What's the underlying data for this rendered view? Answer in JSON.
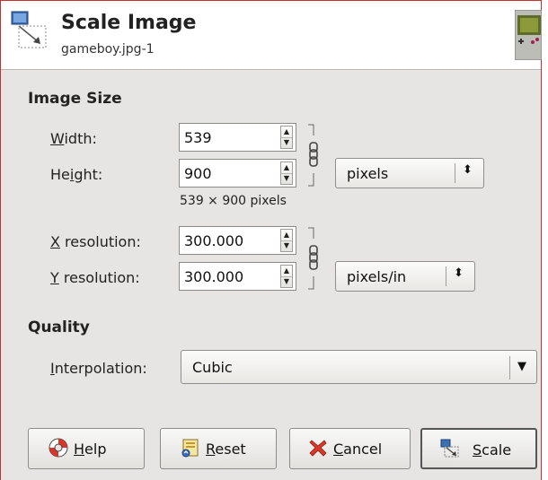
{
  "header": {
    "title": "Scale Image",
    "subtitle": "gameboy.jpg-1"
  },
  "image_size": {
    "section_title": "Image Size",
    "width": {
      "label_pre": "",
      "label_mnemonic": "W",
      "label_post": "idth:",
      "value": "539"
    },
    "height": {
      "label_pre": "He",
      "label_mnemonic": "i",
      "label_post": "ght:",
      "value": "900"
    },
    "size_unit": "pixels",
    "size_summary": "539 × 900 pixels",
    "xres": {
      "label_pre": "",
      "label_mnemonic": "X",
      "label_post": " resolution:",
      "value": "300.000"
    },
    "yres": {
      "label_pre": "",
      "label_mnemonic": "Y",
      "label_post": " resolution:",
      "value": "300.000"
    },
    "res_unit": "pixels/in"
  },
  "quality": {
    "section_title": "Quality",
    "interp_label_mnemonic": "I",
    "interp_label_post": "nterpolation:",
    "interp_value": "Cubic"
  },
  "buttons": {
    "help": {
      "mnemonic": "H",
      "rest": "elp"
    },
    "reset": {
      "mnemonic": "R",
      "rest": "eset"
    },
    "cancel": {
      "mnemonic": "C",
      "rest": "ancel"
    },
    "scale": {
      "mnemonic": "S",
      "rest": "cale"
    }
  },
  "colors": {
    "window_border": "#c9302c",
    "dialog_bg": "#e6e5e3",
    "header_bg": "#ffffff"
  },
  "icons": {
    "header": "scale-image-icon",
    "thumbnail": "gameboy-thumbnail-icon",
    "chain": "chain-link-icon",
    "help": "lifebuoy-icon",
    "reset": "reset-icon",
    "cancel": "cancel-x-icon",
    "scale": "scale-icon"
  }
}
